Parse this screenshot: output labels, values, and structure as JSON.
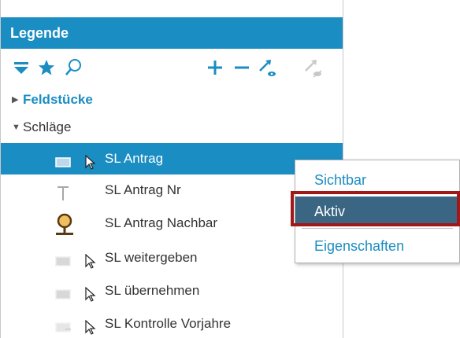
{
  "panel": {
    "title": "Legende"
  },
  "toolbar": {
    "icons": [
      "filter-icon",
      "star-icon",
      "search-icon",
      "plus-icon",
      "minus-icon",
      "show-all-icon",
      "hide-all-icon"
    ]
  },
  "tree": {
    "groups": [
      {
        "label": "Feldstücke",
        "expanded": false
      },
      {
        "label": "Schläge",
        "expanded": true
      }
    ],
    "layers": [
      {
        "label": "SL Antrag",
        "icon": "polygon-layer-icon",
        "selectable": true,
        "selected": true
      },
      {
        "label": "SL Antrag Nr",
        "icon": "text-layer-icon",
        "selectable": false,
        "selected": false
      },
      {
        "label": "SL Antrag Nachbar",
        "icon": "magnifier-layer-icon",
        "selectable": false,
        "selected": false
      },
      {
        "label": "SL weitergeben",
        "icon": "polygon-layer-icon",
        "selectable": true,
        "selected": false
      },
      {
        "label": "SL übernehmen",
        "icon": "polygon-layer-icon",
        "selectable": true,
        "selected": false
      },
      {
        "label": "SL Kontrolle Vorjahre",
        "icon": "polygon-layer-icon",
        "selectable": true,
        "selected": false
      }
    ]
  },
  "context_menu": {
    "items": [
      {
        "label": "Sichtbar"
      },
      {
        "label": "Aktiv",
        "highlighted": true
      },
      {
        "label": "Eigenschaften"
      }
    ]
  },
  "colors": {
    "accent": "#1a8dc2",
    "selected_menu_bg": "#3a6683",
    "highlight_border": "#a01818"
  }
}
